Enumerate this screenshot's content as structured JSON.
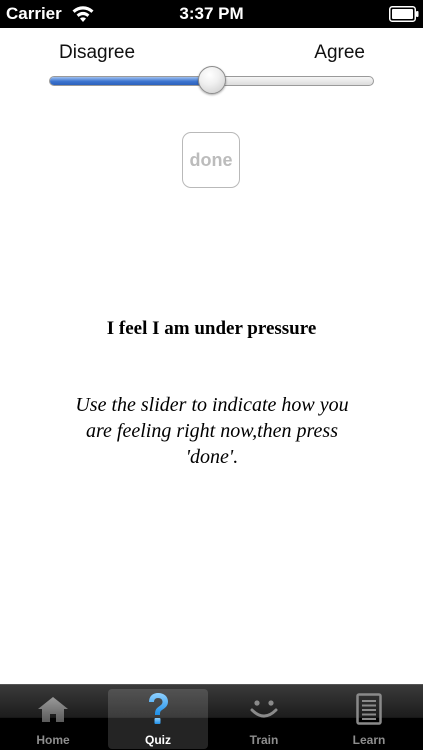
{
  "status_bar": {
    "carrier": "Carrier",
    "time": "3:37 PM"
  },
  "slider": {
    "min_label": "Disagree",
    "max_label": "Agree",
    "value": 0.5,
    "fill_color": "#3c74cf"
  },
  "done_button": {
    "label": "done",
    "enabled": false
  },
  "question": "I feel I am under pressure",
  "instruction": "Use the slider to indicate how you are feeling right now,then press 'done'.",
  "tab_bar": {
    "selected": "Quiz",
    "tabs": [
      {
        "label": "Home",
        "icon": "home-icon"
      },
      {
        "label": "Quiz",
        "icon": "question-mark-icon"
      },
      {
        "label": "Train",
        "icon": "smiley-icon"
      },
      {
        "label": "Learn",
        "icon": "document-icon"
      }
    ]
  }
}
